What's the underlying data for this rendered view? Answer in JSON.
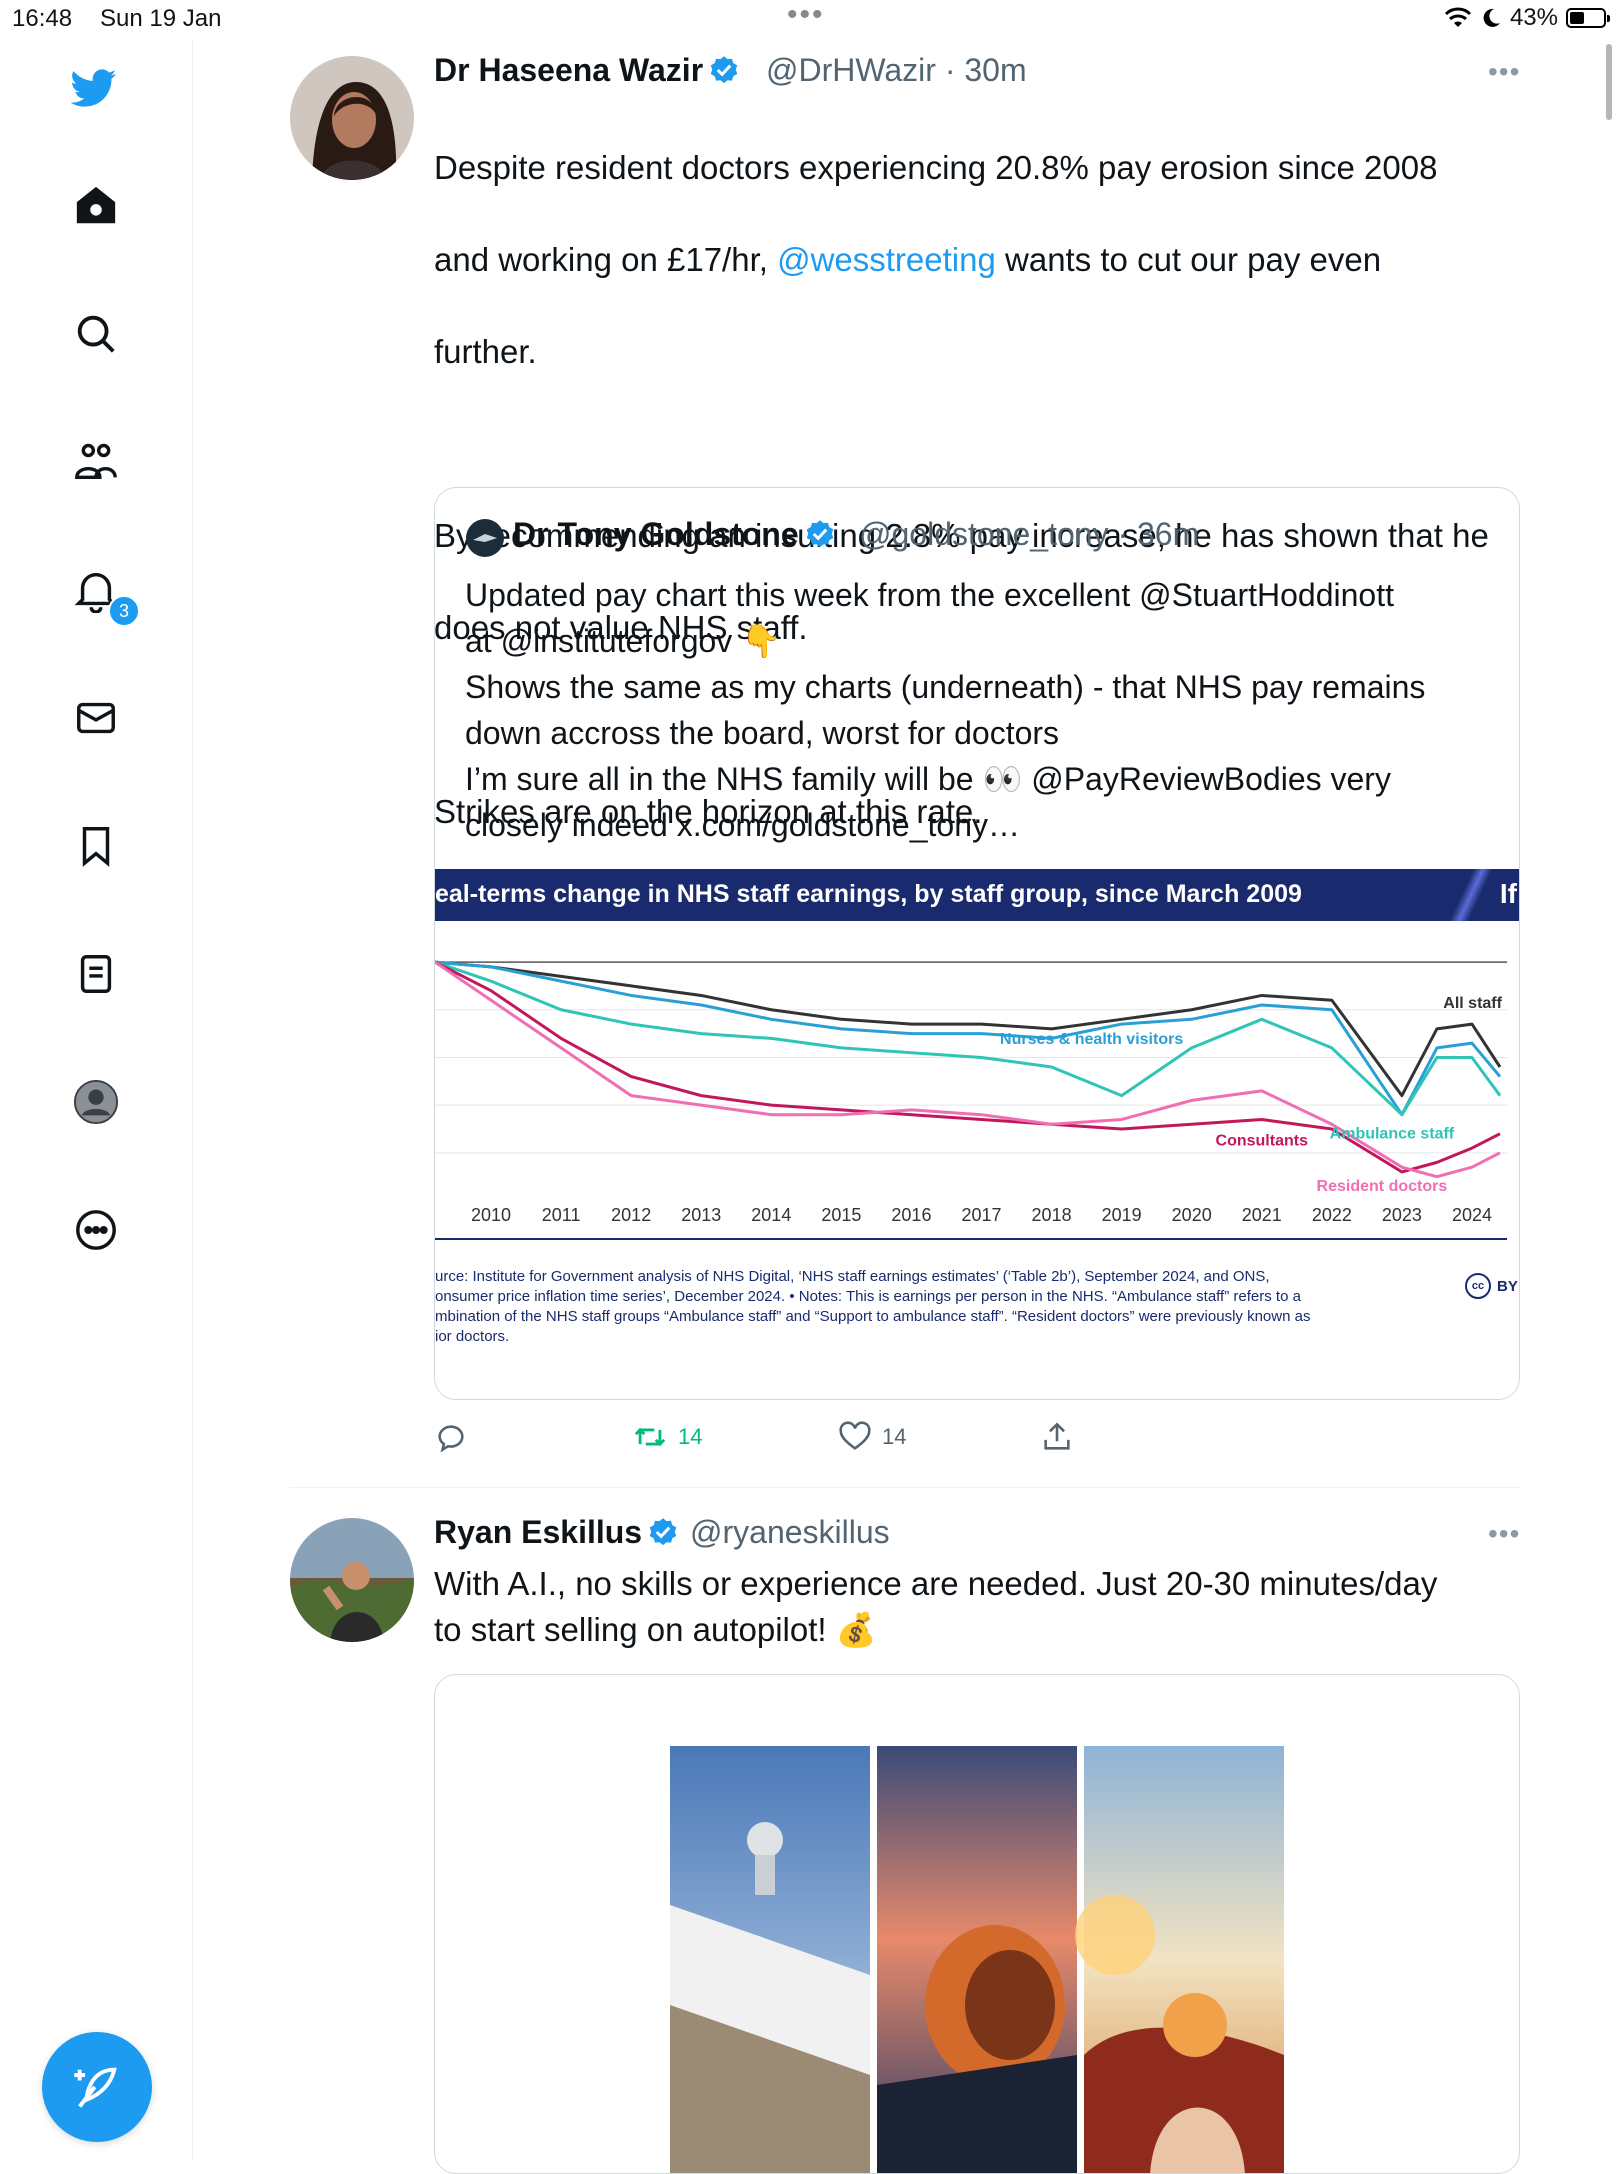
{
  "status_bar": {
    "time": "16:48",
    "date": "Sun 19 Jan",
    "battery": "43%"
  },
  "sidebar": {
    "items": [
      {
        "name": "home",
        "label": "Home"
      },
      {
        "name": "search",
        "label": "Search"
      },
      {
        "name": "communities",
        "label": "Communities"
      },
      {
        "name": "notifications",
        "label": "Notifications",
        "badge": "3"
      },
      {
        "name": "messages",
        "label": "Messages"
      },
      {
        "name": "bookmarks",
        "label": "Bookmarks"
      },
      {
        "name": "lists",
        "label": "Lists"
      },
      {
        "name": "profile",
        "label": "Profile"
      },
      {
        "name": "more",
        "label": "More"
      }
    ],
    "brand_color": "#1d9bf0"
  },
  "tweets": [
    {
      "name": "Dr Haseena Wazir",
      "handle": "@DrHWazir",
      "time": "· 30m",
      "text_1": "Despite resident doctors experiencing 20.8% pay erosion since 2008",
      "text_2a": "and working on £17/hr, ",
      "mention": "@wesstreeting",
      "text_2b": " wants to cut our pay even",
      "text_3": "further.",
      "text_4": "By recommending an insulting 2.8% pay increase, he has shown that he",
      "text_5": "does not value NHS staff.",
      "text_6": "Strikes are on the horizon at this rate.",
      "quote": {
        "name": "Dr Tony Goldstone",
        "handle": "@goldstone_tony · 36m",
        "text": "Updated pay chart this week from the excellent @StuartHoddinott\nat @instituteforgov 👇\nShows the same as my charts (underneath) - that NHS pay remains\ndown accross the board, worst for doctors\nI’m sure all in the NHS family will be 👀 @PayReviewBodies very\nclosely indeed x.com/goldstone_tony…",
        "chart_title": "eal-terms change in NHS staff earnings, by staff group, since March 2009",
        "chart_logo": "If",
        "source": "urce: Institute for Government analysis of NHS Digital, ‘NHS staff earnings estimates’ (‘Table 2b’), September 2024, and ONS,\nonsumer price inflation time series’, December 2024. • Notes: This is earnings per person in the NHS. “Ambulance staff” refers to a\nmbination of the NHS staff groups “Ambulance staff” and “Support to ambulance staff”. “Resident doctors” were previously known as\nior doctors.",
        "license": "BY"
      },
      "retweets": "14",
      "likes": "14"
    },
    {
      "name": "Ryan Eskillus",
      "handle": "@ryaneskillus",
      "text": "With A.I., no skills or experience are needed. Just 20-30 minutes/day\nto start selling on autopilot! 💰"
    }
  ],
  "chart_data": {
    "type": "line",
    "title": "eal-terms change in NHS staff earnings, by staff group, since March 2009",
    "x": [
      2009.2,
      2010,
      2011,
      2012,
      2013,
      2014,
      2015,
      2016,
      2017,
      2018,
      2019,
      2020,
      2021,
      2022,
      2023,
      2023.5,
      2024,
      2024.4
    ],
    "xticks": [
      "2010",
      "2011",
      "2012",
      "2013",
      "2014",
      "2015",
      "2016",
      "2017",
      "2018",
      "2019",
      "2020",
      "2021",
      "2022",
      "2023",
      "2024"
    ],
    "xlim": [
      2009.2,
      2024.5
    ],
    "ylim": [
      -24,
      2
    ],
    "grid": true,
    "series": [
      {
        "name": "All staff",
        "color": "#333333",
        "values": [
          0,
          -0.5,
          -1.5,
          -2.5,
          -3.5,
          -5,
          -6,
          -6.5,
          -6.5,
          -7,
          -6,
          -5,
          -3.5,
          -4,
          -14,
          -7,
          -6.5,
          -11
        ]
      },
      {
        "name": "Nurses & health visitors",
        "color": "#2a9fd6",
        "values": [
          0,
          -0.5,
          -2,
          -3.5,
          -4.5,
          -6,
          -7,
          -7.5,
          -7.5,
          -8,
          -6.5,
          -6,
          -4.5,
          -5,
          -16,
          -9,
          -8.5,
          -12
        ]
      },
      {
        "name": "Ambulance staff",
        "color": "#2ec4b6",
        "values": [
          0,
          -2,
          -5,
          -6.5,
          -7.5,
          -8,
          -9,
          -9.5,
          -10,
          -11,
          -14,
          -9,
          -6,
          -9,
          -16,
          -10,
          -10,
          -14
        ]
      },
      {
        "name": "Consultants",
        "color": "#c2185b",
        "values": [
          0,
          -3,
          -8,
          -12,
          -14,
          -15,
          -15.5,
          -16,
          -16.5,
          -17,
          -17.5,
          -17,
          -16.5,
          -17.5,
          -22,
          -21,
          -19.5,
          -18
        ]
      },
      {
        "name": "Resident doctors",
        "color": "#f06eb4",
        "values": [
          0,
          -4,
          -9,
          -14,
          -15,
          -16,
          -16,
          -15.5,
          -16,
          -17,
          -16.5,
          -14.5,
          -13.5,
          -17,
          -21.5,
          -22.5,
          -21.5,
          -20
        ]
      }
    ]
  }
}
